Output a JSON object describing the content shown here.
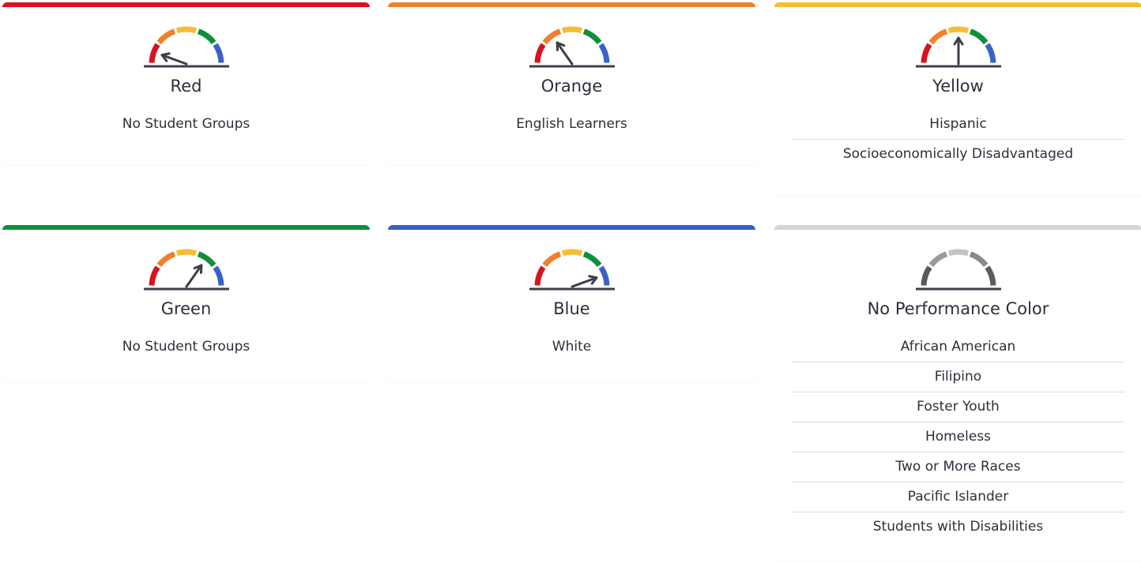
{
  "cards": [
    {
      "status": "Red",
      "accent": "#d7131d",
      "needle_angle": 160,
      "groups": [
        "No Student Groups"
      ]
    },
    {
      "status": "Orange",
      "accent": "#f17f2d",
      "needle_angle": 125,
      "groups": [
        "English Learners"
      ]
    },
    {
      "status": "Yellow",
      "accent": "#f7bd2f",
      "needle_angle": 90,
      "groups": [
        "Hispanic",
        "Socioeconomically Disadvantaged"
      ]
    },
    {
      "status": "Green",
      "accent": "#0f8f3d",
      "needle_angle": 55,
      "groups": [
        "No Student Groups"
      ]
    },
    {
      "status": "Blue",
      "accent": "#3a61c8",
      "needle_angle": 20,
      "groups": [
        "White"
      ]
    },
    {
      "status": "No Performance Color",
      "accent": "#d4d4d4",
      "needle_angle": null,
      "groups": [
        "African American",
        "Filipino",
        "Foster Youth",
        "Homeless",
        "Two or More Races",
        "Pacific Islander",
        "Students with Disabilities"
      ]
    }
  ]
}
